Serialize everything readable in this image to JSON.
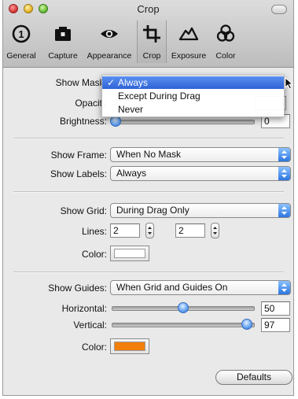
{
  "window": {
    "title": "Crop"
  },
  "toolbar": [
    {
      "label": "General",
      "icon": "info-circle-icon",
      "selected": false
    },
    {
      "label": "Capture",
      "icon": "camera-icon",
      "selected": false
    },
    {
      "label": "Appearance",
      "icon": "eye-icon",
      "selected": false
    },
    {
      "label": "Crop",
      "icon": "crop-icon",
      "selected": true
    },
    {
      "label": "Exposure",
      "icon": "exposure-icon",
      "selected": false
    },
    {
      "label": "Color",
      "icon": "color-circles-icon",
      "selected": false
    }
  ],
  "mask": {
    "show_label": "Show Mask:",
    "opacity_label": "Opacity",
    "brightness_label": "Brightness:",
    "brightness_value": "0",
    "brightness_level": 0,
    "menu_items": [
      {
        "label": "Always",
        "checked": true,
        "highlighted": true
      },
      {
        "label": "Except During Drag",
        "checked": false,
        "highlighted": false
      },
      {
        "label": "Never",
        "checked": false,
        "highlighted": false
      }
    ]
  },
  "frame": {
    "label": "Show Frame:",
    "value": "When No Mask"
  },
  "labels": {
    "label": "Show Labels:",
    "value": "Always"
  },
  "grid": {
    "label": "Show Grid:",
    "value": "During Drag Only",
    "lines_label": "Lines:",
    "lines_a": "2",
    "lines_b": "2",
    "color_label": "Color:",
    "color": "#ffffff"
  },
  "guides": {
    "label": "Show Guides:",
    "value": "When Grid and Guides On",
    "horizontal_label": "Horizontal:",
    "horizontal_value": "50",
    "horizontal_level": 0.5,
    "vertical_label": "Vertical:",
    "vertical_value": "97",
    "vertical_level": 0.97,
    "color_label": "Color:",
    "color": "#f27e0b"
  },
  "defaults_label": "Defaults",
  "accent": "#3d7de6"
}
